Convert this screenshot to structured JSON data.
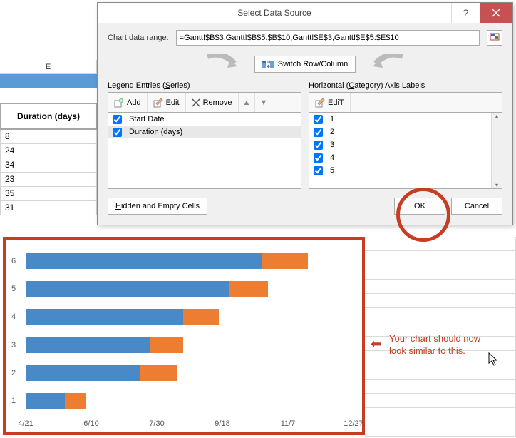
{
  "sheet": {
    "col_label": "E",
    "header": "Duration (days)",
    "values": [
      "8",
      "24",
      "34",
      "23",
      "35",
      "31"
    ]
  },
  "dialog": {
    "title": "Select Data Source",
    "range_label_pre": "Chart ",
    "range_label_u": "d",
    "range_label_post": "ata range:",
    "range_value": "=Gantt!$B$3,Gantt!$B$5:$B$10,Gantt!$E$3,Gantt!$E$5:$E$10",
    "switch_label_pre": "S",
    "switch_label_u": "w",
    "switch_label_post": "itch Row/Column",
    "legend_title_pre": "Legend Entries (",
    "legend_title_u": "S",
    "legend_title_post": "eries)",
    "axis_title_pre": "Horizontal (",
    "axis_title_u": "C",
    "axis_title_post": "ategory) Axis Labels",
    "add_u": "A",
    "add_rest": "dd",
    "edit_u": "E",
    "edit_rest": "dit",
    "edit2_u": "T",
    "edit2_pre": "Edi",
    "remove_u": "R",
    "remove_rest": "emove",
    "series": [
      "Start Date",
      "Duration (days)"
    ],
    "categories": [
      "1",
      "2",
      "3",
      "4",
      "5"
    ],
    "hidden_u": "H",
    "hidden_rest": "idden and Empty Cells",
    "ok": "OK",
    "cancel": "Cancel"
  },
  "annotation": {
    "line1": "Your chart should now",
    "line2": "look similar to this."
  },
  "chart_data": {
    "type": "bar",
    "orientation": "horizontal",
    "stacked": true,
    "categories": [
      "1",
      "2",
      "3",
      "4",
      "5",
      "6"
    ],
    "x_ticks": [
      "4/21",
      "6/10",
      "7/30",
      "9/18",
      "11/7",
      "12/27"
    ],
    "series": [
      {
        "name": "Start Date",
        "color": "#4a89c8",
        "values_frac": [
          0.12,
          0.35,
          0.38,
          0.48,
          0.62,
          0.72
        ]
      },
      {
        "name": "Duration (days)",
        "color": "#ed7d31",
        "values_frac": [
          0.062,
          0.11,
          0.1,
          0.11,
          0.12,
          0.14
        ]
      }
    ]
  }
}
